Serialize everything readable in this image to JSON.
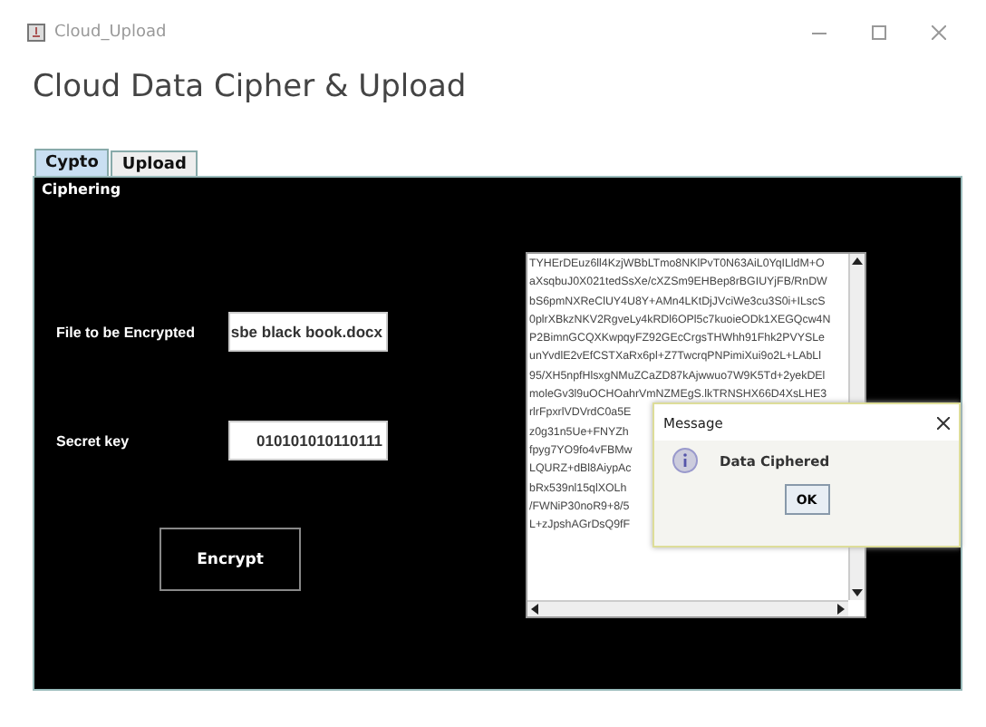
{
  "window": {
    "title": "Cloud_Upload"
  },
  "heading": "Cloud Data Cipher & Upload",
  "tabs": [
    {
      "label": "Cypto",
      "selected": true
    },
    {
      "label": "Upload",
      "selected": false
    }
  ],
  "panel": {
    "title": "Ciphering",
    "fields": [
      {
        "label": "File to be Encrypted",
        "value": "sbe black book.docx"
      },
      {
        "label": "Secret key",
        "value": "010101010110111"
      }
    ],
    "button": "Encrypt",
    "output_lines": [
      "TYHErDEuz6ll4KzjWBbLTmo8NKlPvT0N63AiL0YqILldM+O",
      "aXsqbuJ0X021tedSsXe/cXZSm9EHBep8rBGIUYjFB/RnDW",
      "bS6pmNXReClUY4U8Y+AMn4LKtDjJVciWe3cu3S0i+ILscS",
      "0plrXBkzNKV2RgveLy4kRDl6OPl5c7kuoieODk1XEGQcw4N",
      "P2BimnGCQXKwpqyFZ92GEcCrgsTHWhh91Fhk2PVYSLe",
      "unYvdlE2vEfCSTXaRx6pl+Z7TwcrqPNPimiXui9o2L+LAbLl",
      "95/XH5npfHlsxgNMuZCaZD87kAjwwuo7W9K5Td+2yekDEl",
      "moleGv3l9uOCHOahrVmNZMEgS.lkTRNSHX66D4XsLHE3",
      "rlrFpxrlVDVrdC0a5E",
      "z0g31n5Ue+FNYZh",
      "fpyg7YO9fo4vFBMw",
      "LQURZ+dBl8AiypAc",
      "bRx539nl15qlXOLh",
      "/FWNiP30noR9+8/5",
      "L+zJpshAGrDsQ9fF"
    ]
  },
  "dialog": {
    "title": "Message",
    "message": "Data Ciphered",
    "button": "OK"
  }
}
